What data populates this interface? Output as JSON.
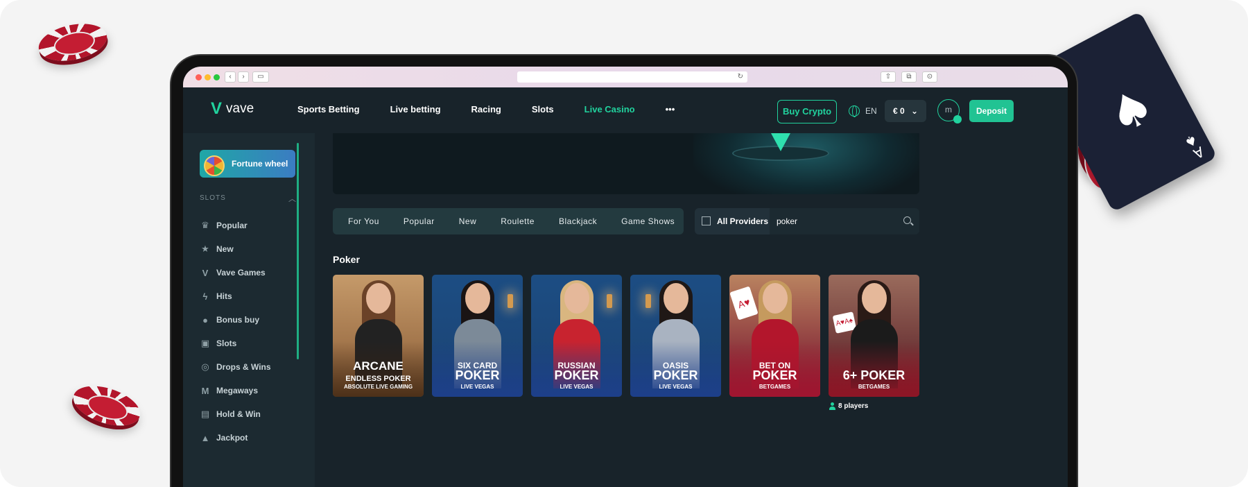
{
  "browser": {
    "traffic_lights": [
      "#ff5f57",
      "#febc2e",
      "#28c840"
    ],
    "back_icon": "chevron-left-icon",
    "forward_icon": "chevron-right-icon",
    "reload_icon": "reload-icon"
  },
  "header": {
    "logo_text": "vave",
    "nav": [
      "Sports Betting",
      "Live betting",
      "Racing",
      "Slots",
      "Live Casino",
      "•••"
    ],
    "buy_crypto": "Buy Crypto",
    "language": "EN",
    "balance": "€ 0",
    "avatar_letter": "m",
    "deposit": "Deposit",
    "accent_color": "#21d39e"
  },
  "sidebar": {
    "fortune_wheel": "Fortune wheel",
    "section_title": "SLOTS",
    "items": [
      {
        "label": "Popular",
        "icon": "crown-icon"
      },
      {
        "label": "New",
        "icon": "star-icon"
      },
      {
        "label": "Vave Games",
        "icon": "vave-icon"
      },
      {
        "label": "Hits",
        "icon": "lightning-icon"
      },
      {
        "label": "Bonus buy",
        "icon": "money-bag-icon"
      },
      {
        "label": "Slots",
        "icon": "slot-machine-icon"
      },
      {
        "label": "Drops & Wins",
        "icon": "coins-icon"
      },
      {
        "label": "Megaways",
        "icon": "megaways-icon"
      },
      {
        "label": "Hold & Win",
        "icon": "hold-win-icon"
      },
      {
        "label": "Jackpot",
        "icon": "jackpot-icon"
      }
    ]
  },
  "main": {
    "tabs": [
      "For You",
      "Popular",
      "New",
      "Roulette",
      "Blackjack",
      "Game Shows"
    ],
    "providers": "All Providers",
    "search_value": "poker",
    "section_title": "Poker",
    "games": [
      {
        "line1": "ARCANE",
        "line2": "ENDLESS POKER",
        "provider": "ABSOLUTE LIVE GAMING"
      },
      {
        "line1": "SIX CARD",
        "line2": "POKER",
        "provider": "LIVE VEGAS"
      },
      {
        "line1": "RUSSIAN",
        "line2": "POKER",
        "provider": "LIVE VEGAS"
      },
      {
        "line1": "OASIS",
        "line2": "POKER",
        "provider": "LIVE VEGAS"
      },
      {
        "line1": "BET ON",
        "line2": "POKER",
        "provider": "BETGAMES"
      },
      {
        "line1": "",
        "line2": "6+ POKER",
        "provider": "BETGAMES"
      }
    ],
    "players": "8 players"
  }
}
